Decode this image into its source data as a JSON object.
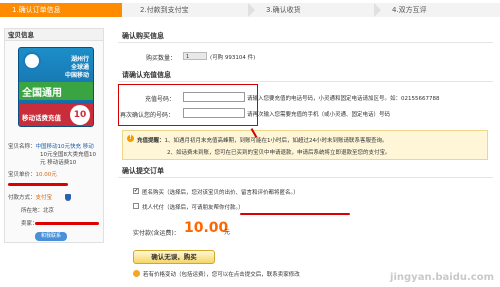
{
  "steps": [
    {
      "label": "1.确认订单信息"
    },
    {
      "label": "2.付款到支付宝"
    },
    {
      "label": "3.确认收货"
    },
    {
      "label": "4.双方互评"
    }
  ],
  "left": {
    "title": "宝贝信息",
    "card": {
      "head1": "湖州行",
      "head2": "全球通",
      "head3": "中国移动",
      "big": "全国通用",
      "foot": "移动话费充值",
      "value": "10"
    },
    "product_label": "宝贝名称：",
    "product_name_1": "中国移动10元快充 移动",
    "product_name_2": "10元全国8大类充值10",
    "product_name_3": "元 移动话费10",
    "price_label": "宝贝单价：",
    "price": "10.00元",
    "paytype_label": "付款方式：",
    "paytype": "支付宝",
    "location_label": "所在地：",
    "location": "北京",
    "seller_label": "卖家：",
    "wangwang": "和我联系"
  },
  "confirm": {
    "title": "确认购买信息",
    "qty_label": "购买数量：",
    "qty_value": "1",
    "qty_hint": "(可购 993104 件)"
  },
  "recharge": {
    "title": "请确认充值信息",
    "phone_label": "充值号码：",
    "phone_value": "",
    "phone_hint": "请输入您要充值的电话号码，小灵通和固定电话请加区号。如：02155667788",
    "confirm_label": "再次确认您的号码：",
    "confirm_value": "",
    "confirm_hint": "请再次输入您需要充值的手机（或小灵通、固定电话）号码"
  },
  "notice": {
    "icon": "!",
    "title": "充值提醒：",
    "line1": "1、如遇月初月末充值高峰期，到账可能在1小时后，如超过24小时未到账请联系客服查询。",
    "line2": "2、如话费未到账，您可在已买到的宝贝中申请退款，申请后系统将立即退款至您的支付宝。"
  },
  "submit": {
    "title": "确认提交订单",
    "anon_label": "匿名购买（选择后，您对该宝贝的出价、留言和评价都将匿名。）",
    "anon_checked": "✔",
    "proxy_label": "找人代付（选择后，可请朋友帮你付款。）",
    "proxy_checked": "",
    "pay_label": "实付款(含运费)：",
    "pay_amount": "10.00",
    "pay_unit": "元",
    "button": "确认无误，购买",
    "tip": "若有价格变动（包括运费），您可以在点击提交后，联系卖家修改"
  },
  "watermark": "jingyan.baidu.com",
  "colors": {
    "accent": "#ff8c00",
    "price": "#ff6600",
    "highlight": "#d40000"
  }
}
